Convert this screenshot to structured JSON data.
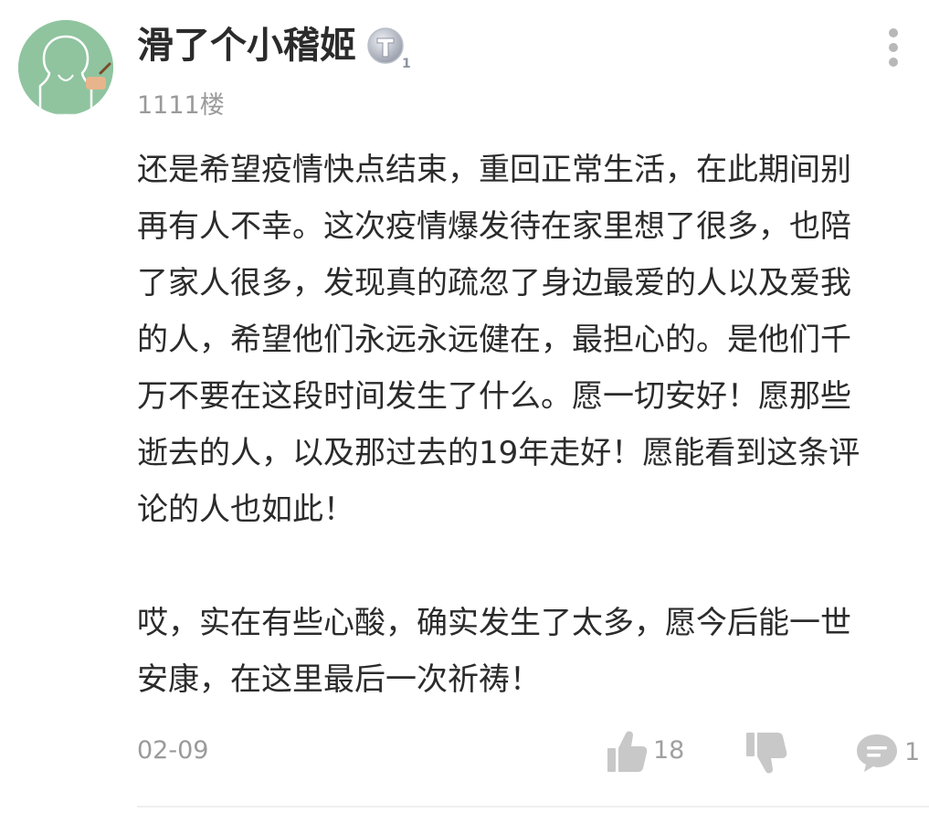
{
  "comment": {
    "username": "滑了个小稽姬",
    "level_badge_icon": "level-t1-badge",
    "floor": "1111楼",
    "paragraph_1_lines": [
      "还是希望疫情快点结束，重回正常生活，在此期间别",
      "再有人不幸。这次疫情爆发待在家里想了很多，也陪",
      "了家人很多，发现真的疏忽了身边最爱的人以及爱我",
      "的人，希望他们永远永远健在，最担心的。是他们千",
      "万不要在这段时间发生了什么。愿一切安好！愿那些",
      "逝去的人，以及那过去的19年走好！愿能看到这条评",
      "论的人也如此！"
    ],
    "paragraph_2_lines": [
      "哎，实在有些心酸，确实发生了太多，愿今后能一世",
      "安康，在这里最后一次祈祷！"
    ],
    "date": "02-09",
    "like_count": "18",
    "reply_count": "1"
  },
  "icons": {
    "avatar": "default-avatar-chalkboard",
    "more": "more-vertical-icon",
    "like": "thumbs-up-icon",
    "dislike": "thumbs-down-icon",
    "reply": "comment-bubble-icon"
  },
  "colors": {
    "text_primary": "#2b2b2b",
    "text_secondary": "#9a9a9a",
    "icon_gray": "#c8c8c8",
    "avatar_bg": "#8fc49f"
  }
}
